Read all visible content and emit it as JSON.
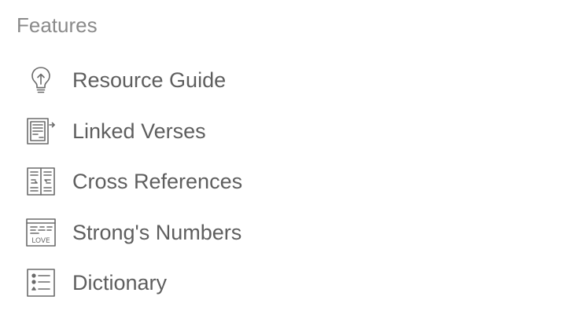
{
  "section": {
    "title": "Features"
  },
  "features": [
    {
      "label": "Resource Guide",
      "icon": "lightbulb-icon"
    },
    {
      "label": "Linked Verses",
      "icon": "linked-verses-icon"
    },
    {
      "label": "Cross References",
      "icon": "cross-references-icon"
    },
    {
      "label": "Strong's Numbers",
      "icon": "strongs-numbers-icon"
    },
    {
      "label": "Dictionary",
      "icon": "dictionary-icon"
    }
  ],
  "colors": {
    "title": "#8a8a8a",
    "label": "#5e5e5e",
    "icon": "#6b6b6b",
    "background": "#ffffff"
  }
}
